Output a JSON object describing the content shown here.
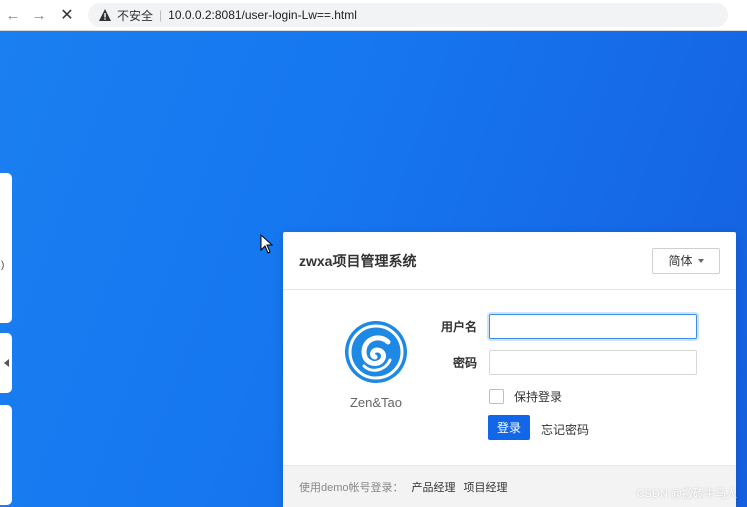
{
  "browser": {
    "security_text": "不安全",
    "separator": "|",
    "url": "10.0.0.2:8081/user-login-Lw==.html"
  },
  "login": {
    "system_title": "zwxa项目管理系统",
    "language": "简体",
    "logo_text": "Zen&Tao",
    "username_label": "用户名",
    "username_value": "",
    "password_label": "密码",
    "password_value": "",
    "remember_label": "保持登录",
    "login_button": "登录",
    "forgot_link": "忘记密码"
  },
  "footer": {
    "demo_label": "使用demo帐号登录：",
    "demo_accounts": [
      "产品经理",
      "项目经理"
    ]
  },
  "watermark": "CSDN @搬砖牛马人",
  "colors": {
    "background_gradient_start": "#1a7ff0",
    "background_gradient_end": "#1560e0",
    "login_button": "#1167e8",
    "input_focus": "#3a8ee6"
  }
}
